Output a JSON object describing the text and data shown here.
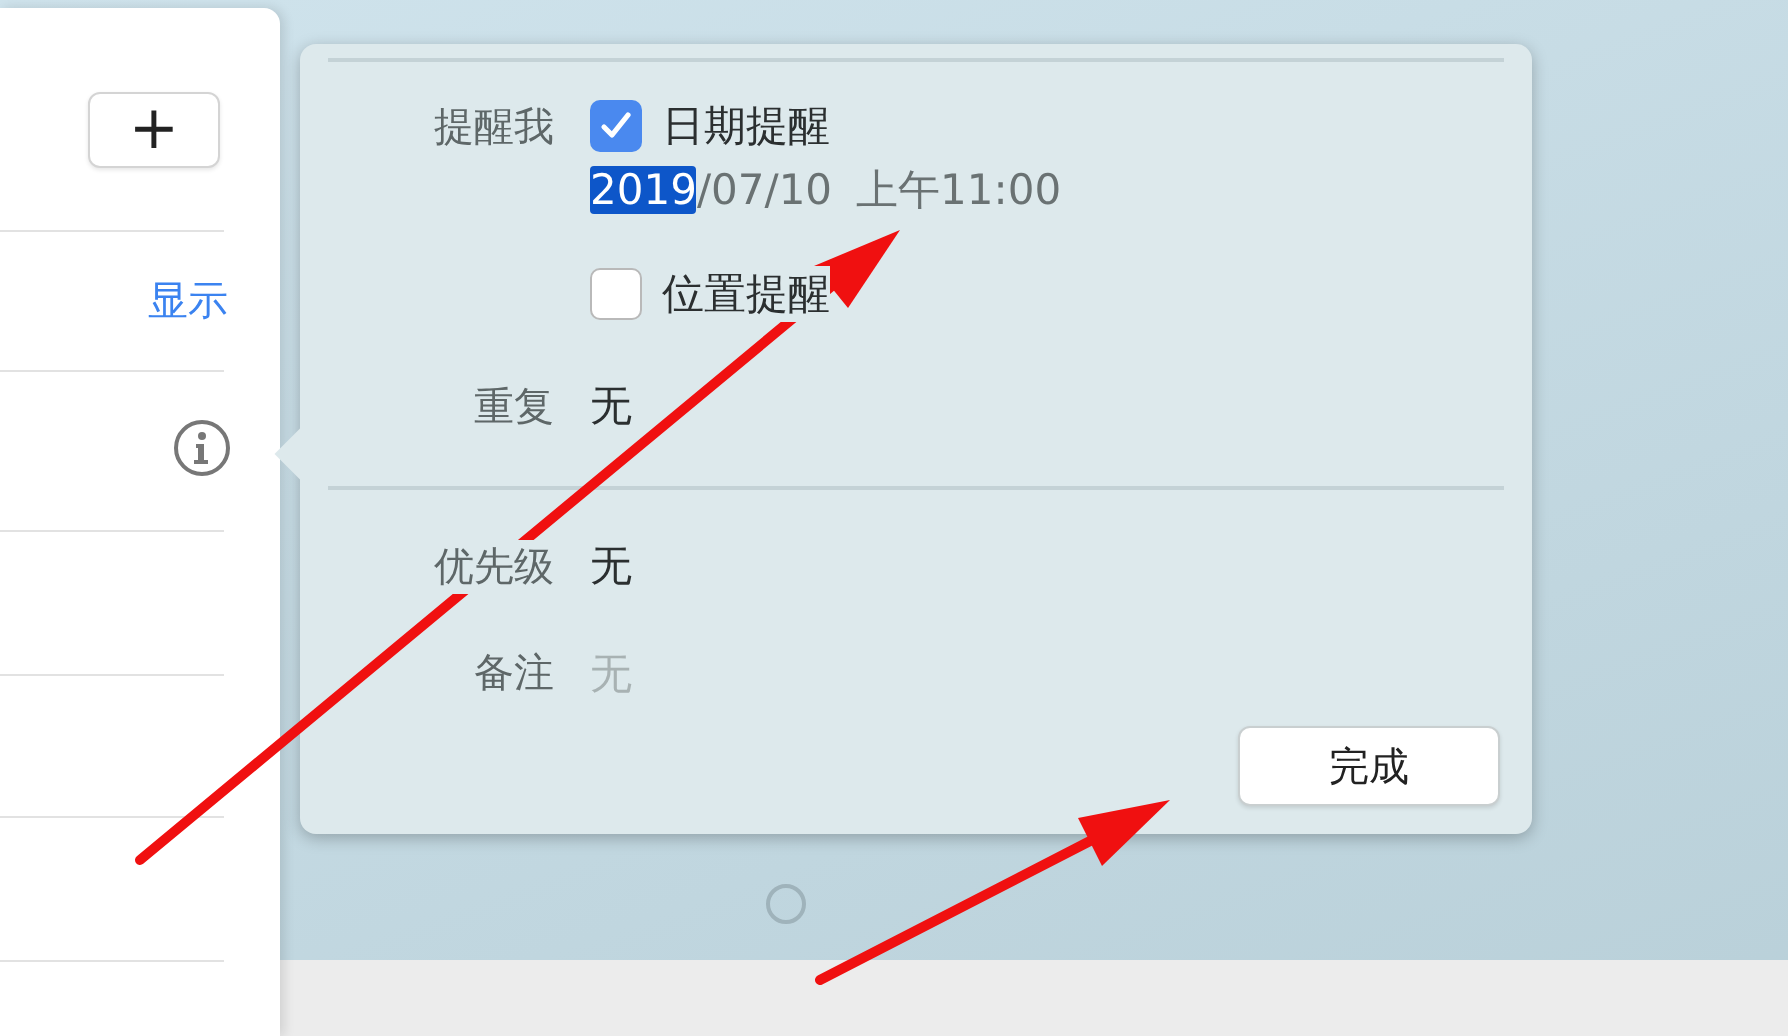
{
  "sidebar": {
    "add_button": "+",
    "show_link": "显示"
  },
  "popover": {
    "remind_label": "提醒我",
    "options": [
      {
        "label": "日期提醒",
        "checked": true
      },
      {
        "label": "位置提醒",
        "checked": false
      }
    ],
    "date": {
      "segments": [
        {
          "text": "2019",
          "selected": true
        },
        {
          "text": "/07/10",
          "selected": false
        }
      ],
      "time": "上午11:00"
    },
    "repeat": {
      "label": "重复",
      "value": "无"
    },
    "priority": {
      "label": "优先级",
      "value": "无"
    },
    "notes": {
      "label": "备注",
      "placeholder": "无"
    },
    "done_button": "完成"
  }
}
